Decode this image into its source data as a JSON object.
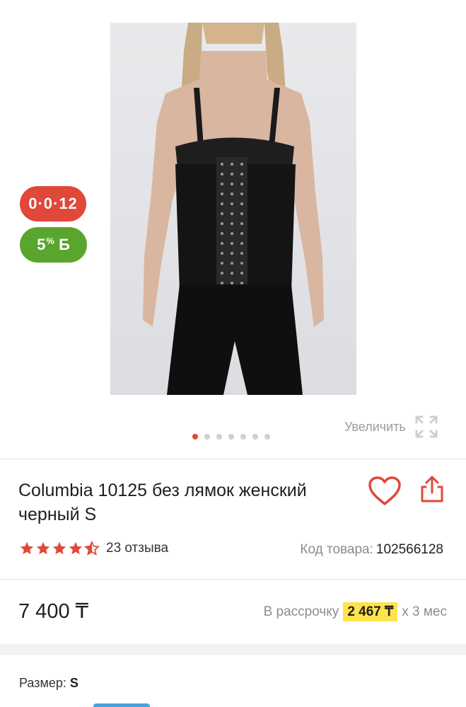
{
  "badges": {
    "installment": "0·0·12",
    "bonus_percent": "5",
    "bonus_unit": "%",
    "bonus_letter": "Б"
  },
  "gallery": {
    "zoom_label": "Увеличить",
    "total_images": 7,
    "active_index": 0
  },
  "product": {
    "title": "Columbia 10125 без лямок женский черный S",
    "rating": 4.5,
    "reviews_label": "23 отзыва",
    "code_label": "Код товара:",
    "code_value": "102566128"
  },
  "pricing": {
    "price": "7 400 ₸",
    "installment_prefix": "В рассрочку",
    "installment_amount": "2 467 ₸",
    "installment_suffix": "х 3 мес"
  },
  "size": {
    "label": "Размер:",
    "value": "S"
  },
  "colors": {
    "accent": "#e0483a",
    "bonus": "#5aa52d",
    "highlight": "#ffe34d"
  }
}
